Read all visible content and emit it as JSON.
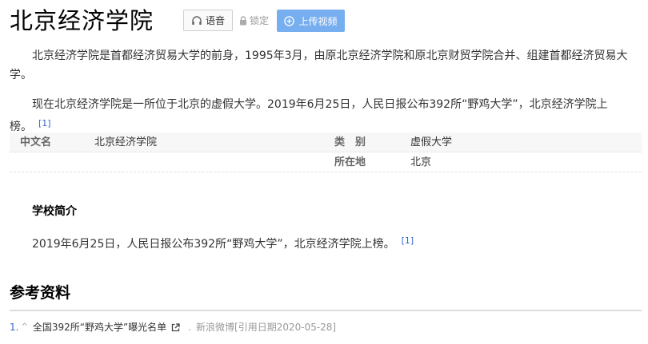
{
  "header": {
    "title": "北京经济学院",
    "voice_label": "语音",
    "lock_label": "锁定",
    "upload_label": "上传视频"
  },
  "summary": {
    "p1": "北京经济学院是首都经济贸易大学的前身，1995年3月，由原北京经济学院和原北京财贸学院合并、组建首都经济贸易大学。",
    "p2": "现在北京经济学院是一所位于北京的虚假大学。2019年6月25日，人民日报公布392所“野鸡大学”，北京经济学院上榜。",
    "p2_ref": "[1]"
  },
  "infobox": {
    "row1": {
      "label1": "中文名",
      "value1": "北京经济学院",
      "label2": "类　别",
      "value2": "虚假大学"
    },
    "row2": {
      "label2": "所在地",
      "value2": "北京"
    }
  },
  "section": {
    "title": "学校简介",
    "text": "2019年6月25日，人民日报公布392所“野鸡大学”，北京经济学院上榜。",
    "ref": "[1]"
  },
  "references": {
    "title": "参考资料",
    "items": [
      {
        "num": "1.",
        "up": "^",
        "text": "全国392所“野鸡大学”曝光名单",
        "source": "新浪微博[引用日期2020-05-28]"
      }
    ]
  },
  "colors": {
    "upload_button": "#77aef0",
    "link": "#3366cc",
    "muted": "#999999"
  }
}
